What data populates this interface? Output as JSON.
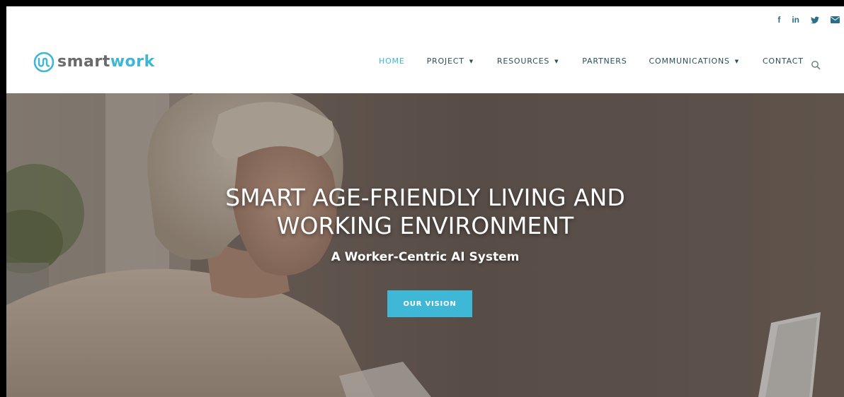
{
  "social": {
    "items": [
      {
        "icon": "facebook-icon",
        "glyph": "f"
      },
      {
        "icon": "linkedin-icon",
        "glyph": "in"
      },
      {
        "icon": "twitter-icon",
        "glyph": "✧"
      },
      {
        "icon": "email-icon",
        "glyph": "✉"
      }
    ]
  },
  "brand": {
    "name_part1": "smart",
    "name_part2": "work",
    "primary_color": "#3fb6d3",
    "text_color": "#6a6a6a"
  },
  "nav": {
    "items": [
      {
        "label": "HOME",
        "has_caret": false,
        "active": true
      },
      {
        "label": "PROJECT",
        "has_caret": true,
        "active": false
      },
      {
        "label": "RESOURCES",
        "has_caret": true,
        "active": false
      },
      {
        "label": "PARTNERS",
        "has_caret": false,
        "active": false
      },
      {
        "label": "COMMUNICATIONS",
        "has_caret": true,
        "active": false
      },
      {
        "label": "CONTACT",
        "has_caret": false,
        "active": false
      }
    ],
    "caret_glyph": "▼",
    "search_icon": "search-icon"
  },
  "hero": {
    "title_line1": "SMART AGE-FRIENDLY LIVING AND",
    "title_line2": "WORKING ENVIRONMENT",
    "subtitle": "A Worker-Centric AI System",
    "button_label": "OUR VISION",
    "button_color": "#3fb8d8"
  }
}
